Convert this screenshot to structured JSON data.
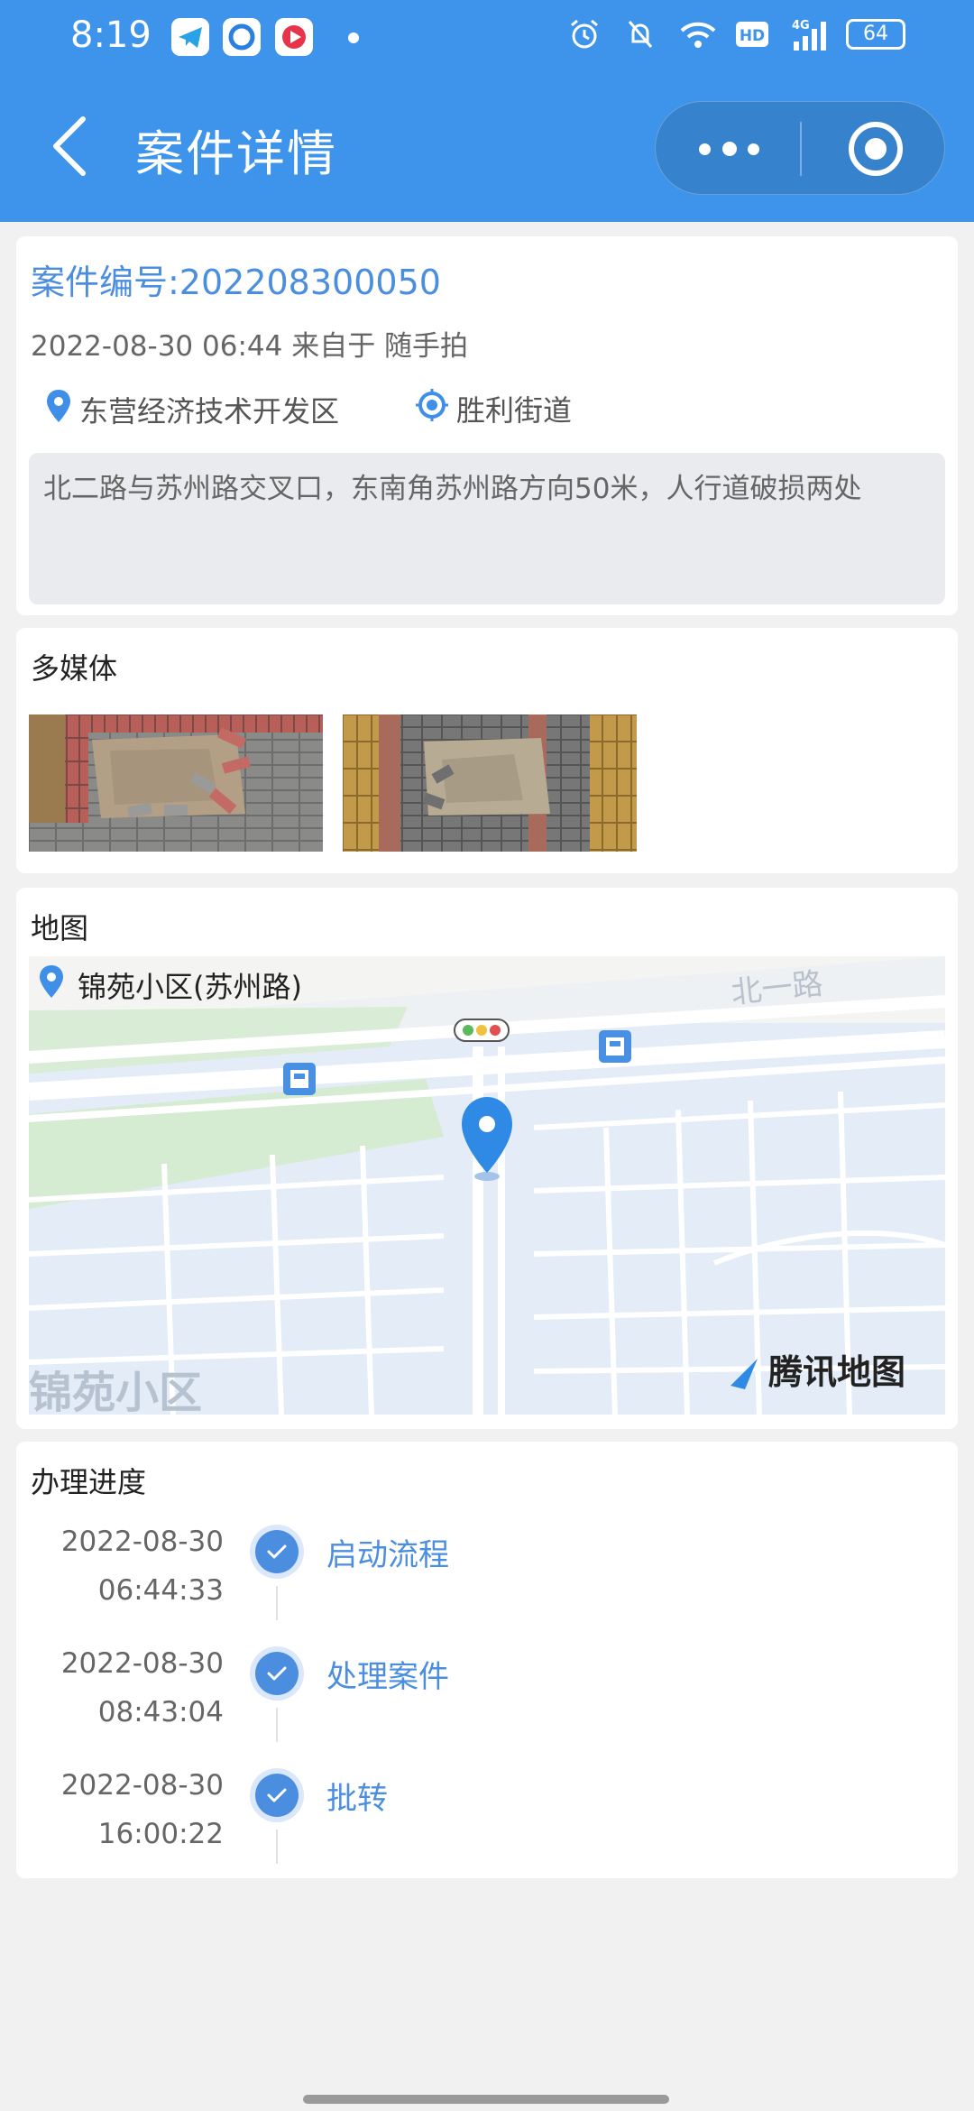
{
  "status_bar": {
    "time": "8:19",
    "battery": "64",
    "icons": [
      "telegram-app-icon",
      "circle-app-icon",
      "video-app-icon",
      "notification-dot",
      "alarm-icon",
      "mute-icon",
      "wifi-icon",
      "hd-icon",
      "4g-signal-icon",
      "battery-icon"
    ]
  },
  "nav": {
    "title": "案件详情",
    "icons": [
      "back-icon",
      "more-icon",
      "close-target-icon"
    ]
  },
  "case": {
    "number": "案件编号:202208300050",
    "meta": "2022-08-30 06:44 来自于 随手拍",
    "district": "东营经济技术开发区",
    "street": "胜利街道",
    "description": "北二路与苏州路交叉口，东南角苏州路方向50米，人行道破损两处"
  },
  "media": {
    "title": "多媒体",
    "photos": [
      "damaged-sidewalk-photo-1",
      "damaged-sidewalk-photo-2"
    ]
  },
  "map": {
    "title": "地图",
    "location": "锦苑小区(苏州路)",
    "road_label": "北一路",
    "area_label": "锦苑小区",
    "brand": "腾讯地图"
  },
  "progress": {
    "title": "办理进度",
    "steps": [
      {
        "date": "2022-08-30",
        "time": "06:44:33",
        "label": "启动流程"
      },
      {
        "date": "2022-08-30",
        "time": "08:43:04",
        "label": "处理案件"
      },
      {
        "date": "2022-08-30",
        "time": "16:00:22",
        "label": "批转"
      }
    ]
  },
  "colors": {
    "primary": "#3e94ea",
    "accent_text": "#4b8ee0",
    "page_bg": "#f1f1f1"
  }
}
